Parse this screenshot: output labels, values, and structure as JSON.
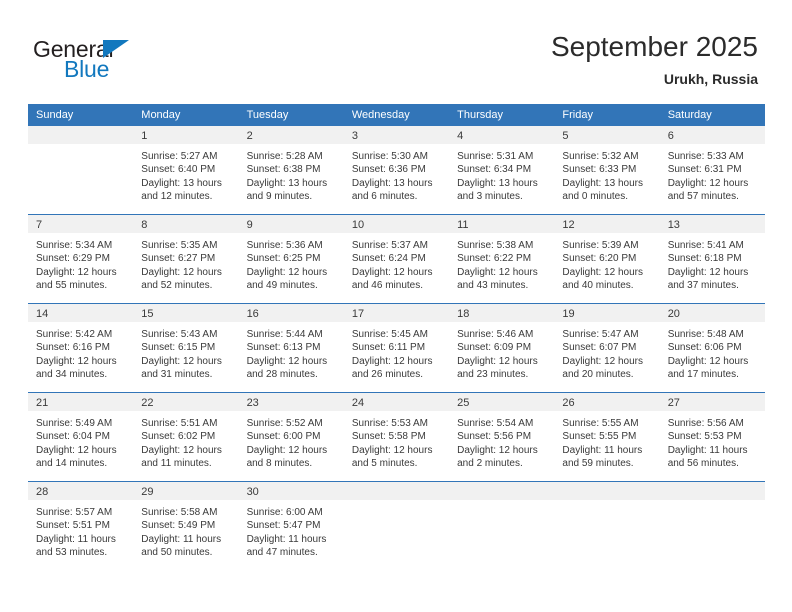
{
  "brand": {
    "name_top": "General",
    "name_bottom": "Blue",
    "color_dark": "#231f20",
    "color_blue": "#1278be"
  },
  "header": {
    "title": "September 2025",
    "location": "Urukh, Russia"
  },
  "theme": {
    "header_bar": "#3275b8",
    "daynum_band": "#f1f1f1",
    "text": "#3a3a3a"
  },
  "weekdays": [
    "Sunday",
    "Monday",
    "Tuesday",
    "Wednesday",
    "Thursday",
    "Friday",
    "Saturday"
  ],
  "weeks": [
    [
      {
        "day": "",
        "lines": []
      },
      {
        "day": "1",
        "lines": [
          "Sunrise: 5:27 AM",
          "Sunset: 6:40 PM",
          "Daylight: 13 hours",
          "and 12 minutes."
        ]
      },
      {
        "day": "2",
        "lines": [
          "Sunrise: 5:28 AM",
          "Sunset: 6:38 PM",
          "Daylight: 13 hours",
          "and 9 minutes."
        ]
      },
      {
        "day": "3",
        "lines": [
          "Sunrise: 5:30 AM",
          "Sunset: 6:36 PM",
          "Daylight: 13 hours",
          "and 6 minutes."
        ]
      },
      {
        "day": "4",
        "lines": [
          "Sunrise: 5:31 AM",
          "Sunset: 6:34 PM",
          "Daylight: 13 hours",
          "and 3 minutes."
        ]
      },
      {
        "day": "5",
        "lines": [
          "Sunrise: 5:32 AM",
          "Sunset: 6:33 PM",
          "Daylight: 13 hours",
          "and 0 minutes."
        ]
      },
      {
        "day": "6",
        "lines": [
          "Sunrise: 5:33 AM",
          "Sunset: 6:31 PM",
          "Daylight: 12 hours",
          "and 57 minutes."
        ]
      }
    ],
    [
      {
        "day": "7",
        "lines": [
          "Sunrise: 5:34 AM",
          "Sunset: 6:29 PM",
          "Daylight: 12 hours",
          "and 55 minutes."
        ]
      },
      {
        "day": "8",
        "lines": [
          "Sunrise: 5:35 AM",
          "Sunset: 6:27 PM",
          "Daylight: 12 hours",
          "and 52 minutes."
        ]
      },
      {
        "day": "9",
        "lines": [
          "Sunrise: 5:36 AM",
          "Sunset: 6:25 PM",
          "Daylight: 12 hours",
          "and 49 minutes."
        ]
      },
      {
        "day": "10",
        "lines": [
          "Sunrise: 5:37 AM",
          "Sunset: 6:24 PM",
          "Daylight: 12 hours",
          "and 46 minutes."
        ]
      },
      {
        "day": "11",
        "lines": [
          "Sunrise: 5:38 AM",
          "Sunset: 6:22 PM",
          "Daylight: 12 hours",
          "and 43 minutes."
        ]
      },
      {
        "day": "12",
        "lines": [
          "Sunrise: 5:39 AM",
          "Sunset: 6:20 PM",
          "Daylight: 12 hours",
          "and 40 minutes."
        ]
      },
      {
        "day": "13",
        "lines": [
          "Sunrise: 5:41 AM",
          "Sunset: 6:18 PM",
          "Daylight: 12 hours",
          "and 37 minutes."
        ]
      }
    ],
    [
      {
        "day": "14",
        "lines": [
          "Sunrise: 5:42 AM",
          "Sunset: 6:16 PM",
          "Daylight: 12 hours",
          "and 34 minutes."
        ]
      },
      {
        "day": "15",
        "lines": [
          "Sunrise: 5:43 AM",
          "Sunset: 6:15 PM",
          "Daylight: 12 hours",
          "and 31 minutes."
        ]
      },
      {
        "day": "16",
        "lines": [
          "Sunrise: 5:44 AM",
          "Sunset: 6:13 PM",
          "Daylight: 12 hours",
          "and 28 minutes."
        ]
      },
      {
        "day": "17",
        "lines": [
          "Sunrise: 5:45 AM",
          "Sunset: 6:11 PM",
          "Daylight: 12 hours",
          "and 26 minutes."
        ]
      },
      {
        "day": "18",
        "lines": [
          "Sunrise: 5:46 AM",
          "Sunset: 6:09 PM",
          "Daylight: 12 hours",
          "and 23 minutes."
        ]
      },
      {
        "day": "19",
        "lines": [
          "Sunrise: 5:47 AM",
          "Sunset: 6:07 PM",
          "Daylight: 12 hours",
          "and 20 minutes."
        ]
      },
      {
        "day": "20",
        "lines": [
          "Sunrise: 5:48 AM",
          "Sunset: 6:06 PM",
          "Daylight: 12 hours",
          "and 17 minutes."
        ]
      }
    ],
    [
      {
        "day": "21",
        "lines": [
          "Sunrise: 5:49 AM",
          "Sunset: 6:04 PM",
          "Daylight: 12 hours",
          "and 14 minutes."
        ]
      },
      {
        "day": "22",
        "lines": [
          "Sunrise: 5:51 AM",
          "Sunset: 6:02 PM",
          "Daylight: 12 hours",
          "and 11 minutes."
        ]
      },
      {
        "day": "23",
        "lines": [
          "Sunrise: 5:52 AM",
          "Sunset: 6:00 PM",
          "Daylight: 12 hours",
          "and 8 minutes."
        ]
      },
      {
        "day": "24",
        "lines": [
          "Sunrise: 5:53 AM",
          "Sunset: 5:58 PM",
          "Daylight: 12 hours",
          "and 5 minutes."
        ]
      },
      {
        "day": "25",
        "lines": [
          "Sunrise: 5:54 AM",
          "Sunset: 5:56 PM",
          "Daylight: 12 hours",
          "and 2 minutes."
        ]
      },
      {
        "day": "26",
        "lines": [
          "Sunrise: 5:55 AM",
          "Sunset: 5:55 PM",
          "Daylight: 11 hours",
          "and 59 minutes."
        ]
      },
      {
        "day": "27",
        "lines": [
          "Sunrise: 5:56 AM",
          "Sunset: 5:53 PM",
          "Daylight: 11 hours",
          "and 56 minutes."
        ]
      }
    ],
    [
      {
        "day": "28",
        "lines": [
          "Sunrise: 5:57 AM",
          "Sunset: 5:51 PM",
          "Daylight: 11 hours",
          "and 53 minutes."
        ]
      },
      {
        "day": "29",
        "lines": [
          "Sunrise: 5:58 AM",
          "Sunset: 5:49 PM",
          "Daylight: 11 hours",
          "and 50 minutes."
        ]
      },
      {
        "day": "30",
        "lines": [
          "Sunrise: 6:00 AM",
          "Sunset: 5:47 PM",
          "Daylight: 11 hours",
          "and 47 minutes."
        ]
      },
      {
        "day": "",
        "lines": []
      },
      {
        "day": "",
        "lines": []
      },
      {
        "day": "",
        "lines": []
      },
      {
        "day": "",
        "lines": []
      }
    ]
  ]
}
